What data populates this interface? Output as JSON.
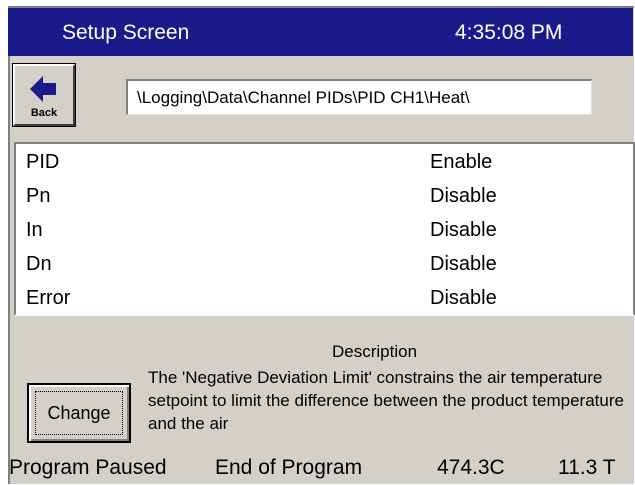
{
  "titlebar": {
    "title": "Setup Screen",
    "time": "4:35:08 PM"
  },
  "back_button": {
    "label": "Back",
    "icon": "left-arrow-icon"
  },
  "path": {
    "value": "\\Logging\\Data\\Channel PIDs\\PID CH1\\Heat\\"
  },
  "list": {
    "rows": [
      {
        "name": "PID",
        "value": "Enable"
      },
      {
        "name": "Pn",
        "value": "Disable"
      },
      {
        "name": "In",
        "value": "Disable"
      },
      {
        "name": "Dn",
        "value": "Disable"
      },
      {
        "name": "Error",
        "value": "Disable"
      }
    ]
  },
  "description": {
    "title": "Description",
    "text": "The 'Negative Deviation Limit' constrains the air temperature setpoint to limit the difference between the product temperature and the air"
  },
  "change_button": {
    "label": "Change"
  },
  "status": {
    "program_state": "Program Paused",
    "program_step": "End of Program",
    "temperature": "474.3C",
    "time_value": "11.3 T"
  },
  "colors": {
    "titlebar": "#1a1a8a",
    "panel": "#d4d0c8",
    "accent_arrow": "#1a1a8a"
  }
}
